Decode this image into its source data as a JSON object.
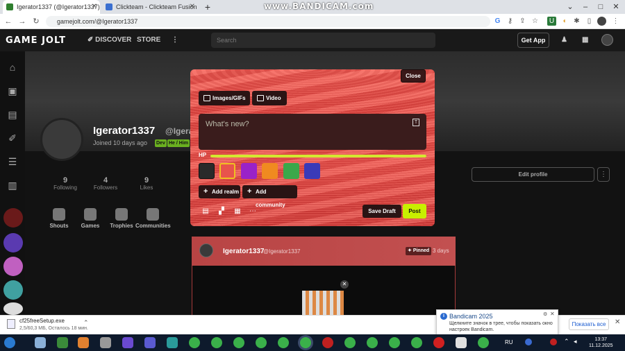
{
  "browser": {
    "tabs": [
      {
        "title": "Igerator1337 (@Igerator1337) - G",
        "active": true
      },
      {
        "title": "Clickteam - Clickteam Fusion 2.5",
        "active": false
      }
    ],
    "new_tab": "+",
    "url": "gamejolt.com/@Igerator1337",
    "watermark": "www.BANDICAM.com"
  },
  "gamejolt": {
    "logo": "GAME JOLT",
    "nav": {
      "discover": "DISCOVER",
      "store": "STORE"
    },
    "search_placeholder": "Search",
    "get_app": "Get App"
  },
  "profile": {
    "name": "Igerator1337",
    "handle": "@Igera",
    "joined": "Joined 10 days ago",
    "tags": [
      "Dev",
      "He / Him"
    ],
    "stats": [
      {
        "value": "9",
        "label": "Following"
      },
      {
        "value": "4",
        "label": "Followers"
      },
      {
        "value": "9",
        "label": "Likes"
      }
    ],
    "tabs": [
      "Shouts",
      "Games",
      "Trophies",
      "Communities"
    ],
    "edit_profile": "Edit profile"
  },
  "modal": {
    "close": "Close",
    "images_btn": "Images/GIFs",
    "video_btn": "Video",
    "placeholder": "What's new?",
    "hp_label": "HP",
    "hp_fraction": 1.0,
    "add_realm": "Add realm",
    "add_community": "Add community",
    "save_draft": "Save Draft",
    "post": "Post",
    "swatches": [
      "#2a2a2a",
      "#e8544c",
      "#9a22c8",
      "#f08a20",
      "#3aa84a",
      "#3a3ab8"
    ]
  },
  "feed_post": {
    "name": "Igerator1337",
    "handle": "@Igerator1337",
    "pinned": "Pinned",
    "time": "3 days"
  },
  "notification": {
    "title": "Bandicam 2025",
    "text": "Щелкните значок в трее, чтобы показать окно настроек Bandicam."
  },
  "download": {
    "filename": "cf25freeSetup.exe",
    "status": "2,5/60,3 МБ, Осталось 18 мин.",
    "show_all": "Показать все"
  },
  "taskbar": {
    "lang": "RU",
    "time": "13:37",
    "date": "11.12.2025"
  }
}
